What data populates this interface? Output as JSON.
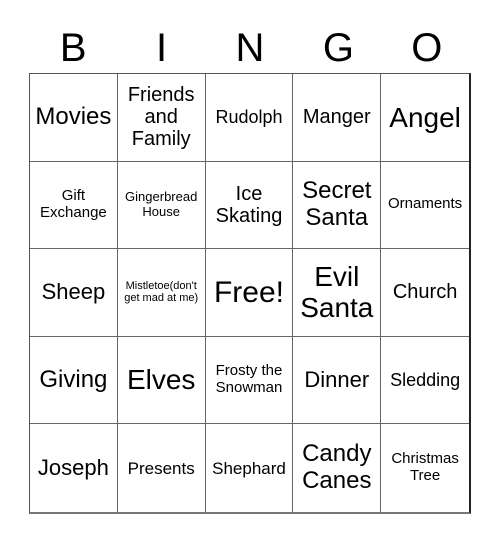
{
  "header": {
    "letters": [
      "B",
      "I",
      "N",
      "G",
      "O"
    ]
  },
  "grid": {
    "rows": [
      [
        "Movies",
        "Friends and Family",
        "Rudolph",
        "Manger",
        "Angel"
      ],
      [
        "Gift Exchange",
        "Gingerbread House",
        "Ice Skating",
        "Secret Santa",
        "Ornaments"
      ],
      [
        "Sheep",
        "Mistletoe(don't get mad at me)",
        "Free!",
        "Evil Santa",
        "Church"
      ],
      [
        "Giving",
        "Elves",
        "Frosty the Snowman",
        "Dinner",
        "Sledding"
      ],
      [
        "Joseph",
        "Presents",
        "Shephard",
        "Candy Canes",
        "Christmas Tree"
      ]
    ]
  }
}
